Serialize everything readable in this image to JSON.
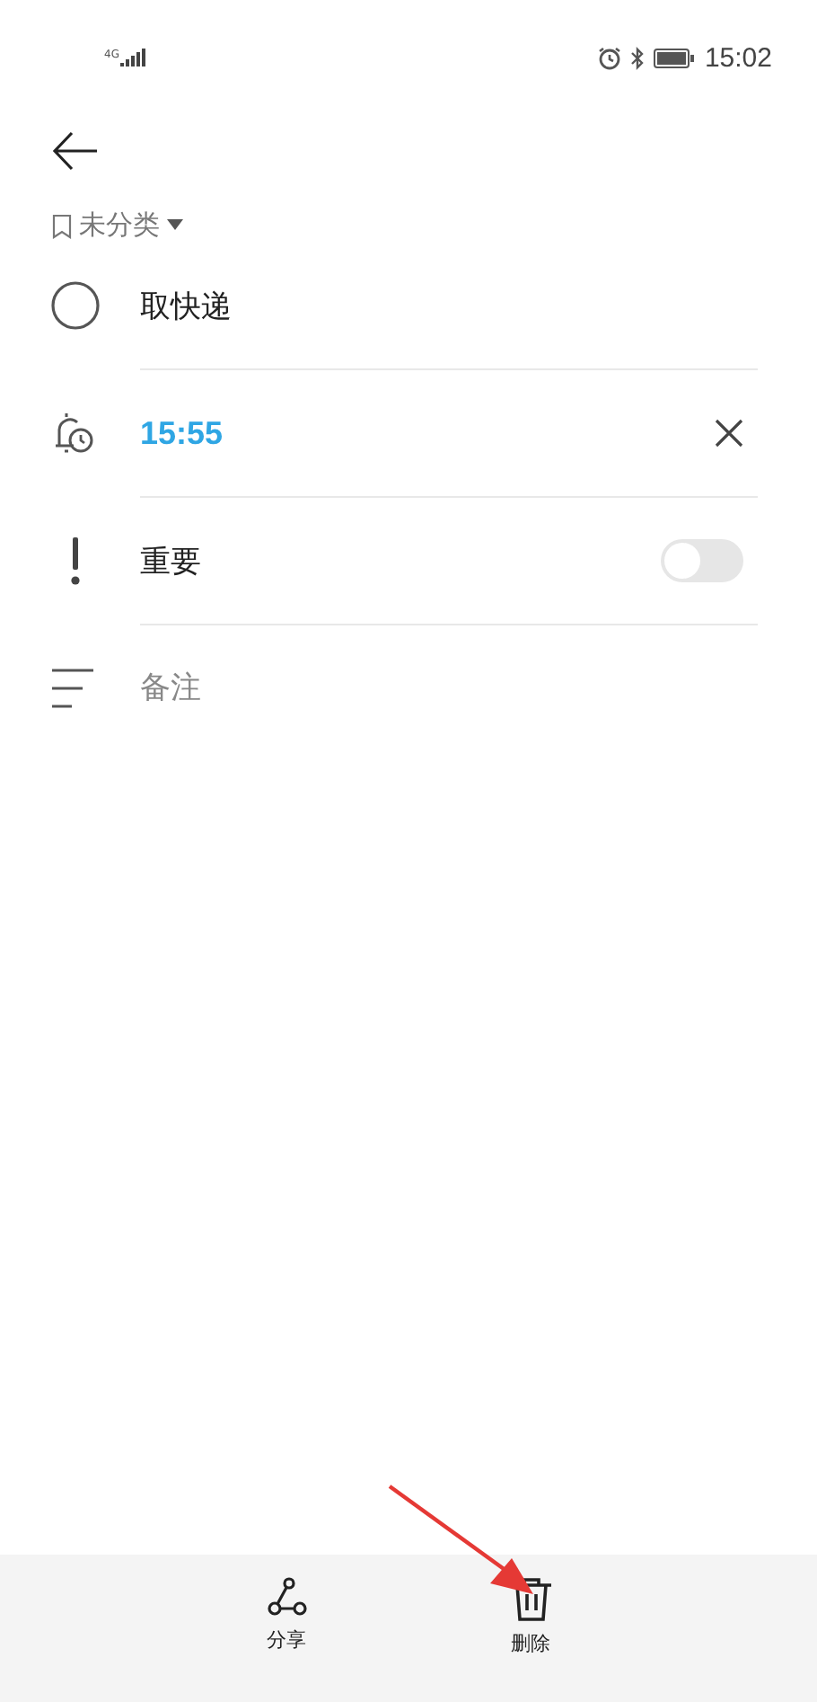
{
  "status_bar": {
    "network": "4G",
    "time": "15:02"
  },
  "category": {
    "label": "未分类"
  },
  "task": {
    "title": "取快递",
    "completed": false
  },
  "reminder": {
    "time": "15:55"
  },
  "important": {
    "label": "重要",
    "on": false
  },
  "notes": {
    "placeholder": "备注"
  },
  "actions": [
    {
      "kind": "share",
      "label": "分享"
    },
    {
      "kind": "delete",
      "label": "删除"
    }
  ],
  "annotation": {
    "kind": "arrow"
  }
}
